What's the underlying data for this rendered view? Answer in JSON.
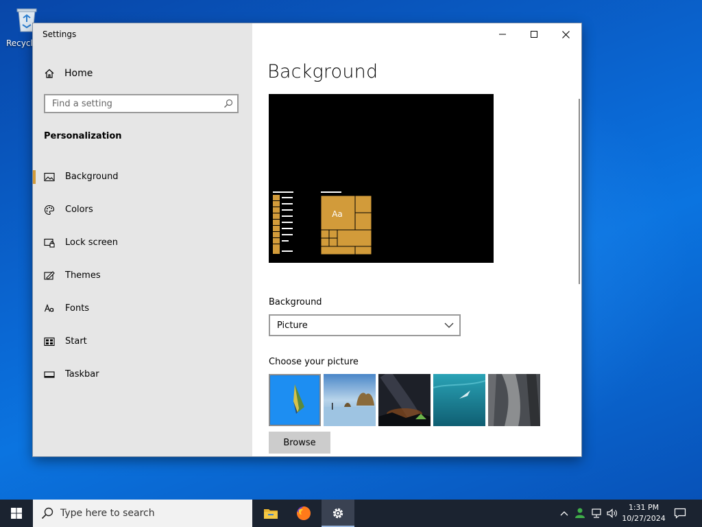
{
  "desktop": {
    "recycle_bin_label": "Recycle"
  },
  "window": {
    "title": "Settings",
    "controls": {
      "minimize": "minimize-icon",
      "maximize": "maximize-icon",
      "close": "close-icon"
    }
  },
  "sidebar": {
    "home_label": "Home",
    "search_placeholder": "Find a setting",
    "section_title": "Personalization",
    "items": [
      {
        "label": "Background",
        "icon": "picture-icon",
        "active": true
      },
      {
        "label": "Colors",
        "icon": "palette-icon",
        "active": false
      },
      {
        "label": "Lock screen",
        "icon": "lock-screen-icon",
        "active": false
      },
      {
        "label": "Themes",
        "icon": "themes-icon",
        "active": false
      },
      {
        "label": "Fonts",
        "icon": "fonts-icon",
        "active": false
      },
      {
        "label": "Start",
        "icon": "start-icon",
        "active": false
      },
      {
        "label": "Taskbar",
        "icon": "taskbar-icon",
        "active": false
      }
    ],
    "accent_color": "#d29b3a"
  },
  "main": {
    "page_title": "Background",
    "preview": {
      "tile_text": "Aa",
      "accent_color": "#d29b3a"
    },
    "background_label": "Background",
    "background_value": "Picture",
    "choose_label": "Choose your picture",
    "browse_label": "Browse"
  },
  "taskbar": {
    "search_placeholder": "Type here to search",
    "apps": [
      "file-explorer-icon",
      "firefox-icon",
      "settings-icon"
    ],
    "time": "1:31 PM",
    "date": "10/27/2024"
  }
}
